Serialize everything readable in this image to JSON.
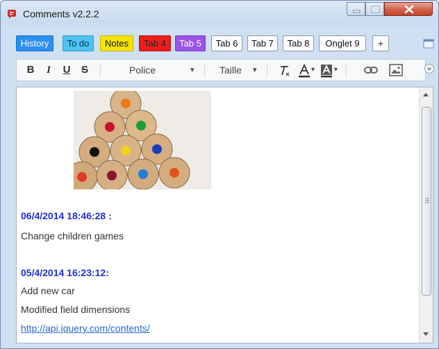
{
  "window": {
    "title": "Comments v2.2.2"
  },
  "tabs": [
    "History",
    "To do",
    "Notes",
    "Tab 4",
    "Tab 5",
    "Tab 6",
    "Tab 7",
    "Tab 8",
    "Onglet 9",
    "+"
  ],
  "toolbar": {
    "bold": "B",
    "italic": "I",
    "underline": "U",
    "strike": "S",
    "font_label": "Police",
    "size_label": "Taille",
    "dropdown_arrow": "▾"
  },
  "entries": [
    {
      "date": "06/4/2014 18:46:28 :",
      "lines": [
        "Change children games"
      ]
    },
    {
      "date": "05/4/2014 16:23:12:",
      "lines": [
        "Add new car",
        "Modified field dimensions"
      ]
    }
  ],
  "link": "http://api.jquery.com/contents/",
  "colors": {
    "history": "#2b8ff0",
    "todo": "#4dc3f1",
    "notes": "#f6e400",
    "tab4": "#ee1c1c",
    "tab5": "#9b54e6",
    "date_text": "#1f2fd6",
    "link": "#2a66c9"
  }
}
